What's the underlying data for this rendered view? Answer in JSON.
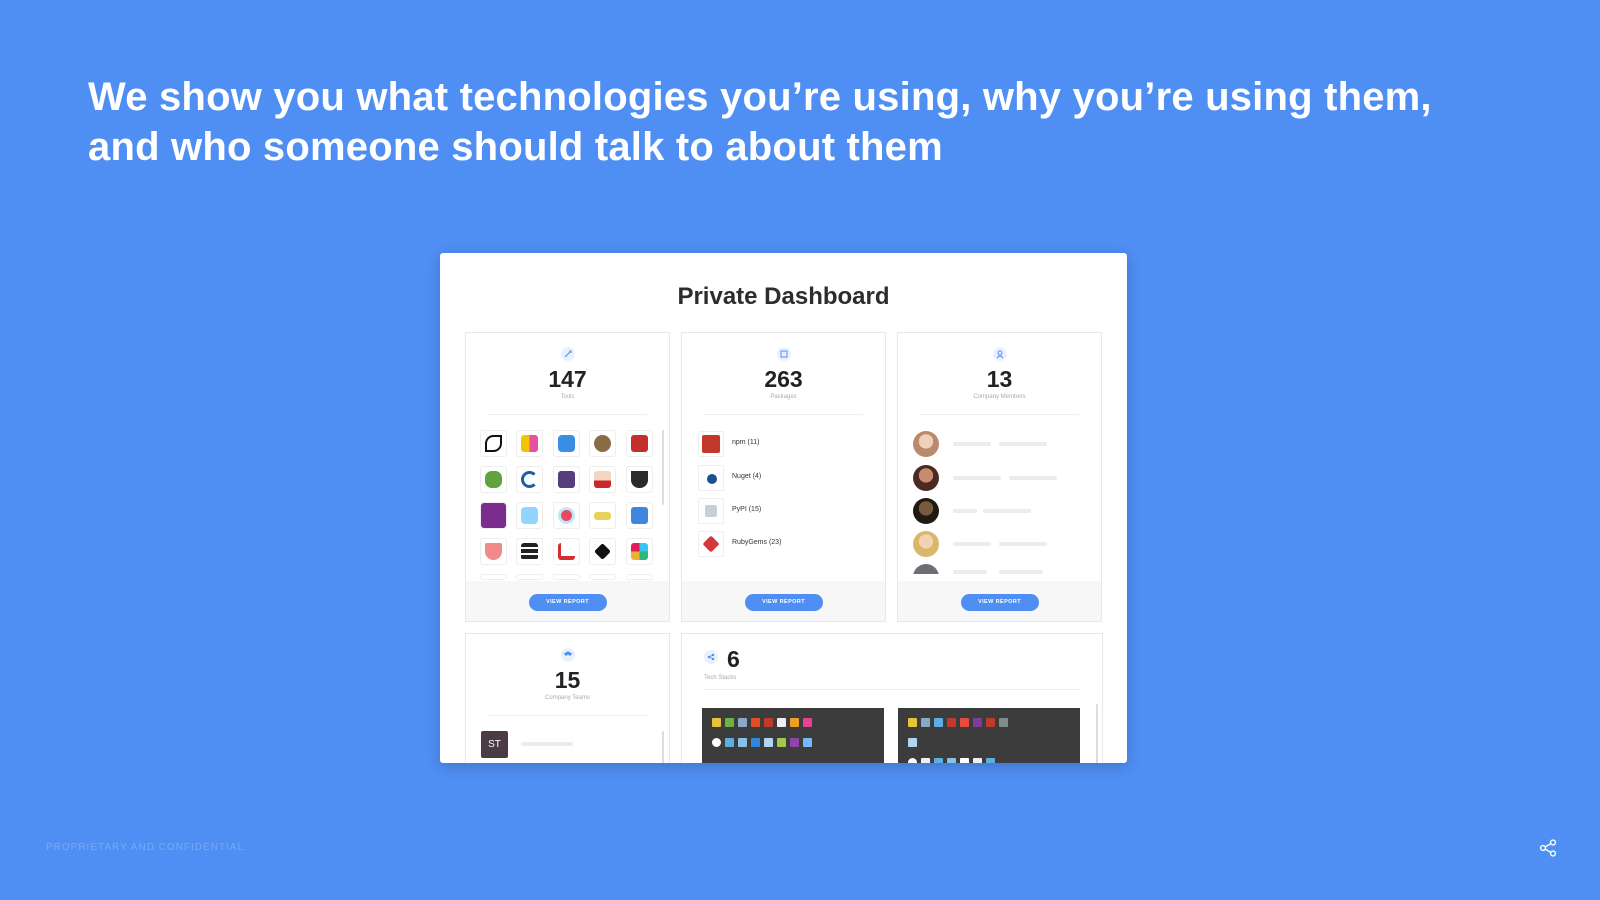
{
  "slide": {
    "headline_line1": "We show you what technologies you’re using, why you’re using them,",
    "headline_line2": "and who someone should talk to about them",
    "footer": "PROPRIETARY AND CONFIDENTIAL",
    "share_icon": "share-icon"
  },
  "dashboard": {
    "title": "Private Dashboard",
    "tools": {
      "count": "147",
      "label": "Tools",
      "button": "VIEW REPORT"
    },
    "packages": {
      "count": "263",
      "label": "Packages",
      "button": "VIEW REPORT",
      "items": [
        {
          "label": "npm (11)",
          "icon": "npm-icon",
          "color": "#c0392b"
        },
        {
          "label": "Nuget (4)",
          "icon": "nuget-icon",
          "color": "#1e4f8f"
        },
        {
          "label": "PyPI (15)",
          "icon": "pypi-icon",
          "color": "#9ba9b6"
        },
        {
          "label": "RubyGems (23)",
          "icon": "rubygems-icon",
          "color": "#d3393b"
        }
      ]
    },
    "members": {
      "count": "13",
      "label": "Company Members",
      "button": "VIEW REPORT"
    },
    "teams": {
      "count": "15",
      "label": "Company Teams",
      "first_team_initials": "ST"
    },
    "stacks": {
      "count": "6",
      "label": "Tech Stacks"
    }
  },
  "colors": {
    "background": "#4f8ef3",
    "accent": "#4f8ef3"
  }
}
